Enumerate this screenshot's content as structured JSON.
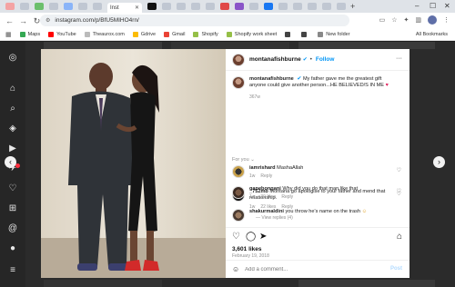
{
  "browser": {
    "active_tab_title": "Inst",
    "url": "instagram.com/p/BfU5MIHO4rn/",
    "bookmarks": [
      "Maps",
      "YouTube",
      "Theaurox.com",
      "Gdrive",
      "Gmail",
      "Shopify",
      "Shopify work sheet",
      "",
      "",
      "New folder"
    ],
    "all_bookmarks": "All Bookmarks",
    "profile_initial": "M"
  },
  "post": {
    "username": "montanafishburne",
    "follow_label": "Follow",
    "caption": "My father gave me the greatest gift anyone could give another person...HE BELIEVED/S IN ME",
    "caption_age": "367w",
    "for_you": "For you",
    "comments": [
      {
        "user": "iamrishard",
        "text": "MashaAllah",
        "age": "1w",
        "likes": "",
        "reply": "Reply"
      },
      {
        "user": "_752mb",
        "text": "Montana go apologise to your father and mend that relationship.",
        "age": "1w",
        "likes": "22 likes",
        "reply": "Reply",
        "view_replies": "View replies (4)"
      },
      {
        "user": "gapebongani",
        "text": "Why did you do that man like that",
        "age": "1w",
        "likes": "39 likes",
        "reply": "Reply"
      },
      {
        "user": "shakurmaldini",
        "text": "you throw he's name on the trash",
        "age": "",
        "likes": "",
        "reply": ""
      }
    ],
    "likes": "3,601 likes",
    "date": "February 19, 2018",
    "comment_placeholder": "Add a comment...",
    "post_label": "Post"
  },
  "colors": {
    "accent": "#0095f6",
    "modal_backdrop": "#2b2b2b"
  }
}
